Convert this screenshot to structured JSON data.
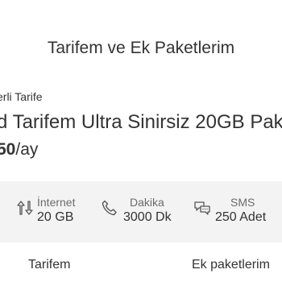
{
  "header": {
    "title": "Tarifem ve Ek Paketlerim"
  },
  "tariff": {
    "kicker": "erli Tarife",
    "name": "d Tarifem Ultra Sinirsiz 20GB Pak",
    "price_amount": "50",
    "price_unit": "/ay"
  },
  "allowances": [
    {
      "label": "İnternet",
      "value": "20 GB",
      "icon": "data-transfer-icon"
    },
    {
      "label": "Dakika",
      "value": "3000 Dk",
      "icon": "phone-icon"
    },
    {
      "label": "SMS",
      "value": "250 Adet",
      "icon": "chat-bubbles-icon"
    }
  ],
  "tabs": [
    {
      "label": "Tarifem"
    },
    {
      "label": "Ek paketlerim"
    }
  ],
  "colors": {
    "text": "#333333",
    "muted": "#6b6b6b",
    "allowance_bg": "#f3f3f3"
  }
}
